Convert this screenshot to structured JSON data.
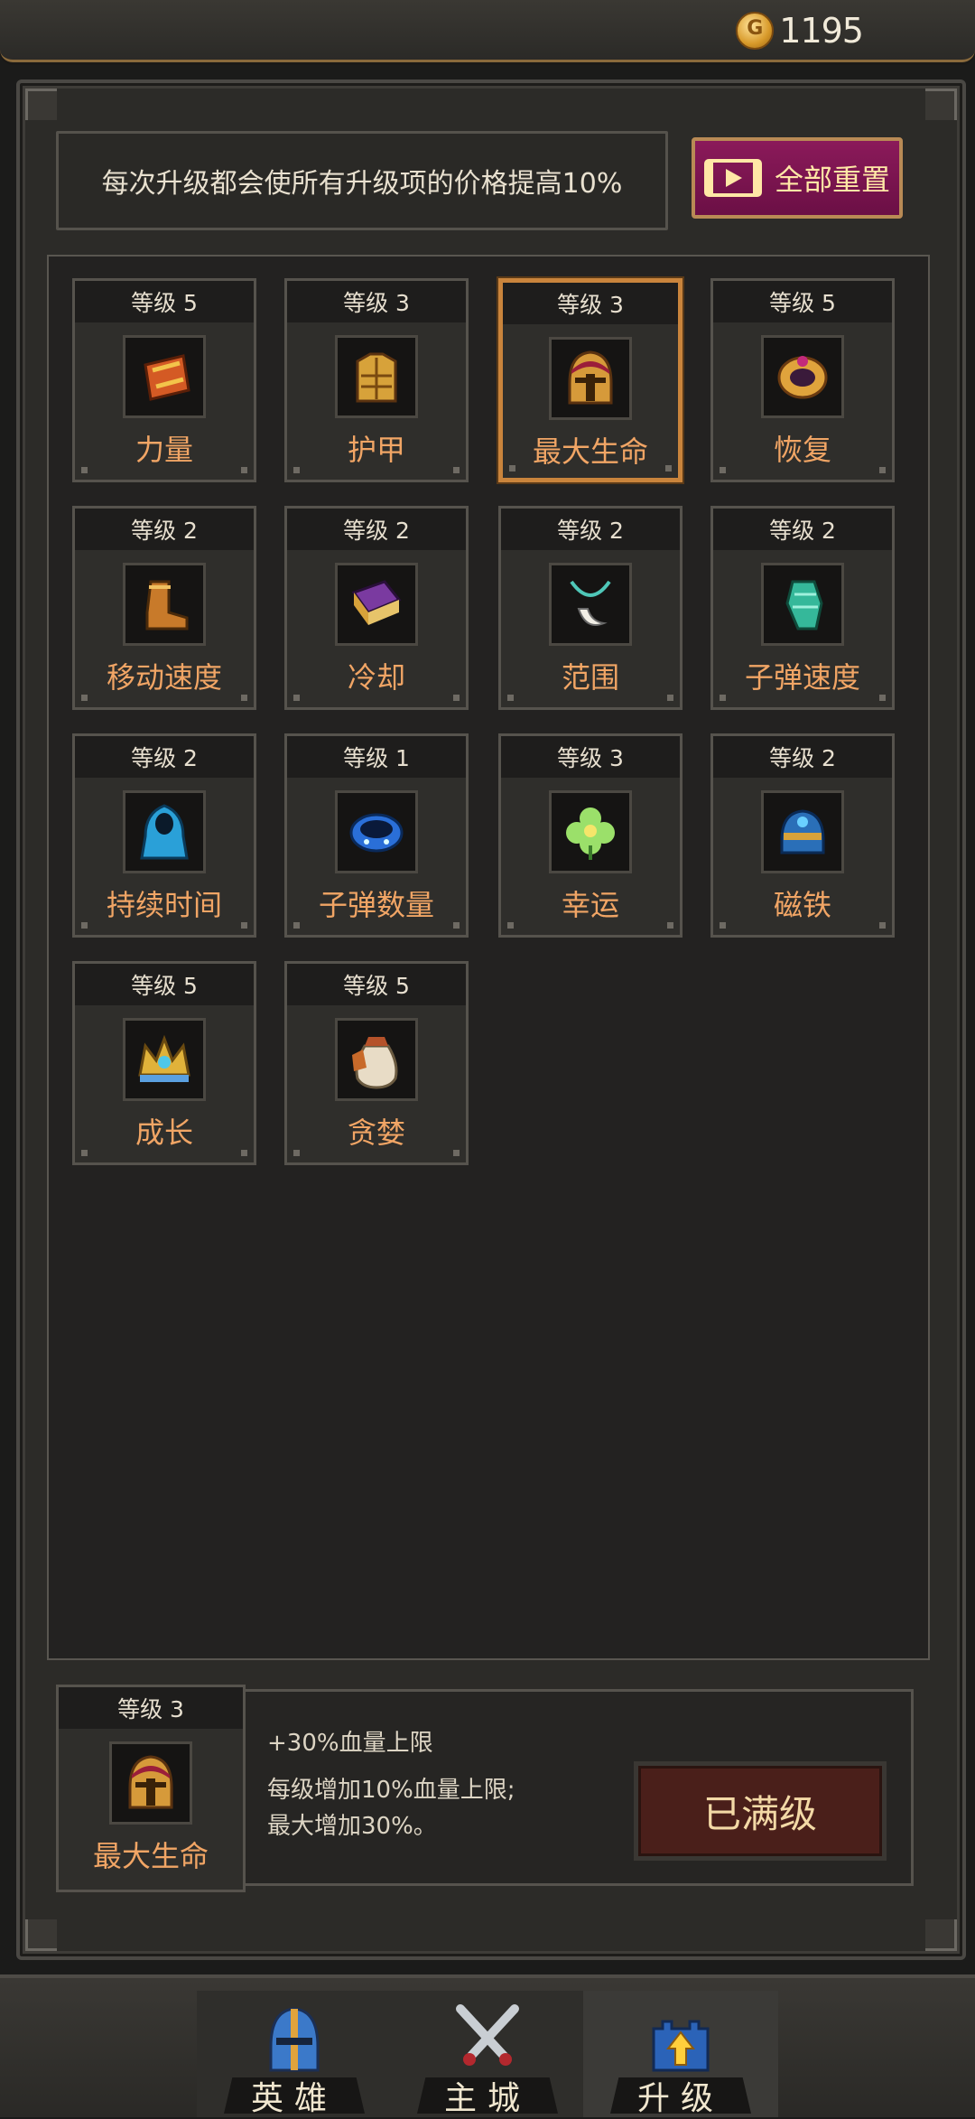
{
  "currency": {
    "icon": "gold-coin-icon",
    "amount": "1195"
  },
  "info": {
    "text": "每次升级都会使所有升级项的价格提高10%"
  },
  "reset_button": {
    "label": "全部重置",
    "icon": "video-icon",
    "color": "#7a134f"
  },
  "level_prefix": "等级",
  "upgrades": [
    {
      "level": "等级 5",
      "name": "力量",
      "icon": "bracer-icon"
    },
    {
      "level": "等级 3",
      "name": "护甲",
      "icon": "armor-icon"
    },
    {
      "level": "等级 3",
      "name": "最大生命",
      "icon": "helmet-icon",
      "selected": true
    },
    {
      "level": "等级 5",
      "name": "恢复",
      "icon": "ring-icon"
    },
    {
      "level": "等级 2",
      "name": "移动速度",
      "icon": "boot-icon"
    },
    {
      "level": "等级 2",
      "name": "冷却",
      "icon": "spellbook-icon"
    },
    {
      "level": "等级 2",
      "name": "范围",
      "icon": "amulet-icon"
    },
    {
      "level": "等级 2",
      "name": "子弹速度",
      "icon": "gauntlet-icon"
    },
    {
      "level": "等级 2",
      "name": "持续时间",
      "icon": "cloak-icon"
    },
    {
      "level": "等级 1",
      "name": "子弹数量",
      "icon": "bracelet-icon"
    },
    {
      "level": "等级 3",
      "name": "幸运",
      "icon": "clover-icon"
    },
    {
      "level": "等级 2",
      "name": "磁铁",
      "icon": "magnet-helm-icon"
    },
    {
      "level": "等级 5",
      "name": "成长",
      "icon": "crown-icon"
    },
    {
      "level": "等级 5",
      "name": "贪婪",
      "icon": "money-bag-icon"
    }
  ],
  "detail": {
    "level": "等级 3",
    "name": "最大生命",
    "icon": "helmet-icon",
    "effect": "+30%血量上限",
    "desc_line1": "每级增加10%血量上限;",
    "desc_line2": "最大增加30%。",
    "button_label": "已满级"
  },
  "nav": [
    {
      "label": "英雄",
      "icon": "hero-helmet-icon"
    },
    {
      "label": "主城",
      "icon": "crossed-swords-icon"
    },
    {
      "label": "升级",
      "icon": "upgrade-castle-icon",
      "active": true
    }
  ],
  "colors": {
    "accent_orange": "#f1a565",
    "selected_border": "#c9843c",
    "maxed_button": "#4a1f1a"
  }
}
